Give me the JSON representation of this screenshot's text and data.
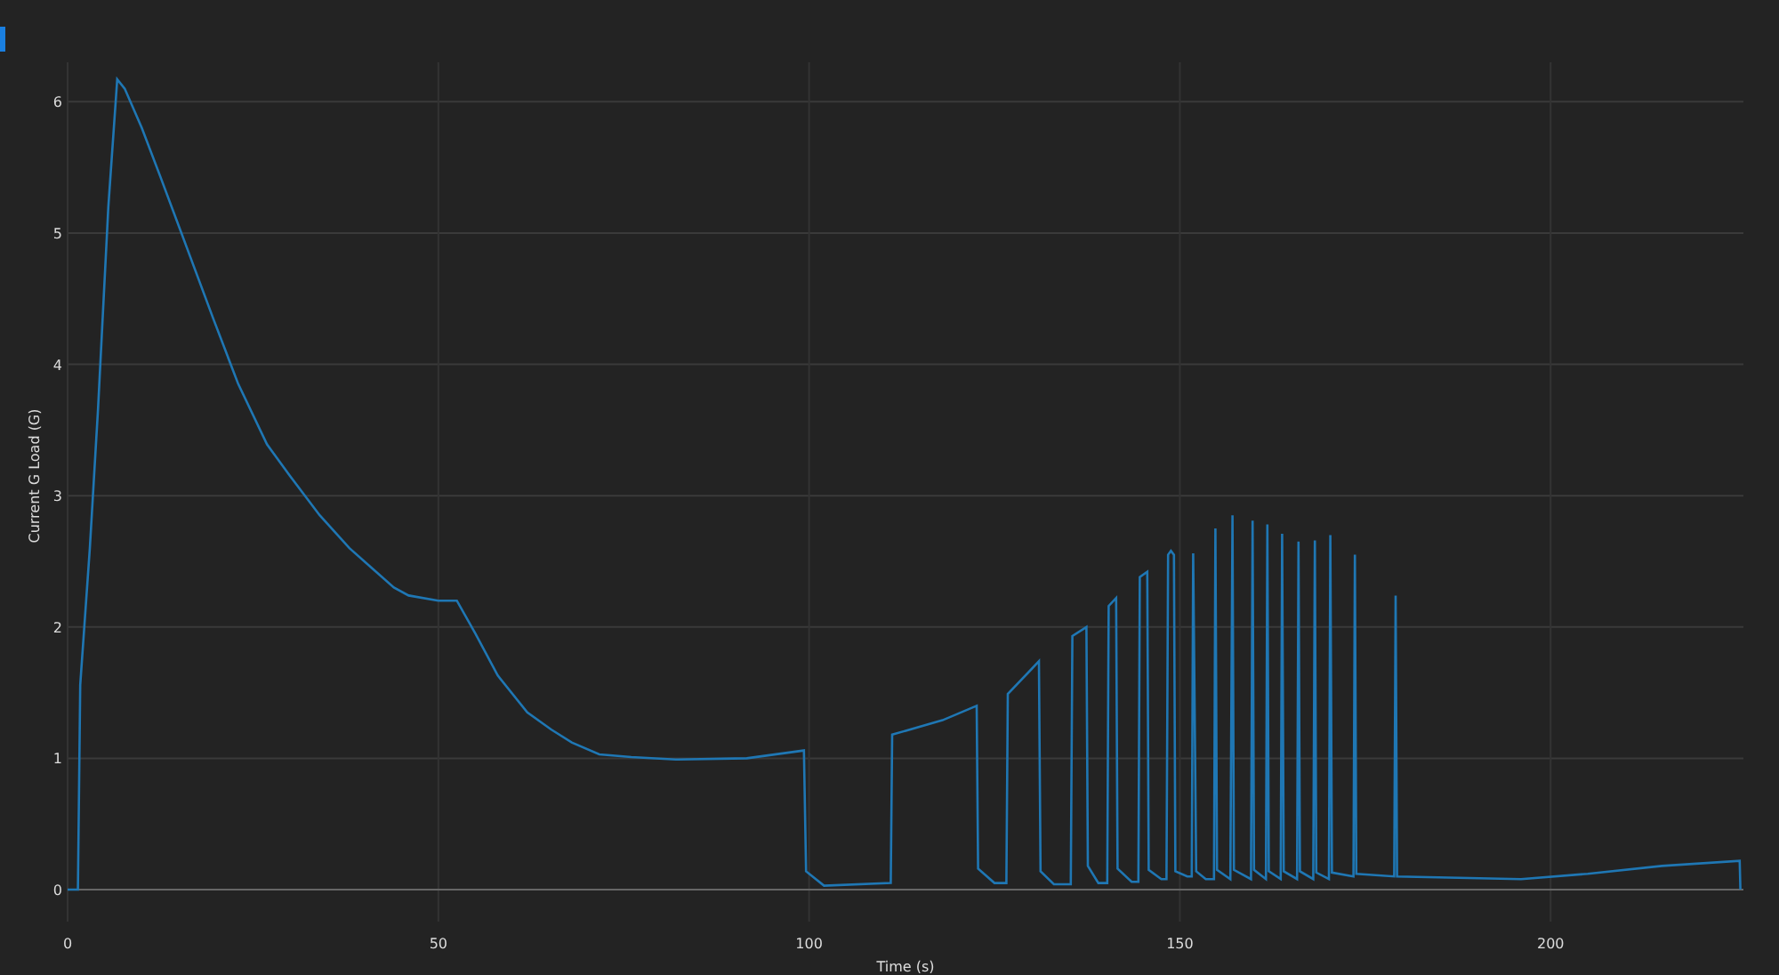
{
  "chart": {
    "chart_data": {
      "type": "line",
      "xlabel": "Time (s)",
      "ylabel": "Current G Load (G)",
      "x": [
        0,
        1.4,
        1.7,
        3,
        4.1,
        5.5,
        6.7,
        7.7,
        10,
        12.5,
        16,
        19.7,
        23,
        26.9,
        30,
        34,
        38,
        41.2,
        44,
        46,
        50,
        52.5,
        55,
        58,
        62,
        65.2,
        68,
        71.7,
        76,
        82,
        91.6,
        99.3,
        99.6,
        102,
        111,
        111.2,
        118,
        122.6,
        122.8,
        125,
        126.6,
        126.8,
        130,
        131,
        131.2,
        133,
        135.3,
        135.5,
        137.4,
        137.6,
        139,
        140.2,
        140.4,
        141.4,
        141.6,
        143.5,
        144.4,
        144.6,
        145.6,
        145.8,
        147.5,
        148.2,
        148.4,
        148.8,
        149.2,
        149.4,
        151,
        151.6,
        151.8,
        152.2,
        153.5,
        154.6,
        154.8,
        155,
        156.8,
        157.1,
        157.3,
        159.6,
        159.8,
        160,
        161.6,
        161.8,
        162,
        163.6,
        163.8,
        164,
        165.8,
        166,
        166.2,
        168,
        168.2,
        168.4,
        170.1,
        170.3,
        170.5,
        173.4,
        173.6,
        173.8,
        178.9,
        179.1,
        179.3,
        196,
        205,
        215,
        225.5,
        225.6
      ],
      "series": [
        {
          "color": "#1f77b4",
          "values": [
            0,
            0,
            1.56,
            2.6,
            3.66,
            5.2,
            6.17,
            6.1,
            5.8,
            5.43,
            4.9,
            4.34,
            3.85,
            3.39,
            3.15,
            2.85,
            2.6,
            2.44,
            2.3,
            2.24,
            2.2,
            2.2,
            1.95,
            1.63,
            1.35,
            1.22,
            1.12,
            1.03,
            1.01,
            0.99,
            1.0,
            1.06,
            0.14,
            0.03,
            0.05,
            1.18,
            1.29,
            1.4,
            0.16,
            0.05,
            0.05,
            1.49,
            1.68,
            1.74,
            0.14,
            0.04,
            0.04,
            1.93,
            2.0,
            0.18,
            0.05,
            0.05,
            2.16,
            2.22,
            0.16,
            0.06,
            0.06,
            2.38,
            2.42,
            0.15,
            0.08,
            0.08,
            2.55,
            2.58,
            2.55,
            0.14,
            0.1,
            0.1,
            2.56,
            0.14,
            0.08,
            0.08,
            2.75,
            0.15,
            0.08,
            2.85,
            0.15,
            0.08,
            2.81,
            0.15,
            0.08,
            2.78,
            0.14,
            0.08,
            2.71,
            0.14,
            0.08,
            2.65,
            0.14,
            0.08,
            2.66,
            0.13,
            0.08,
            2.7,
            0.13,
            0.1,
            2.55,
            0.12,
            0.1,
            2.24,
            0.1,
            0.08,
            0.12,
            0.18,
            0.22,
            0
          ]
        }
      ],
      "grid": true,
      "xlim": [
        0,
        226
      ],
      "ylim": [
        0,
        6.3
      ],
      "xticks": [
        0,
        50,
        100,
        150,
        200
      ],
      "yticks": [
        0,
        1,
        2,
        3,
        4,
        5,
        6
      ]
    }
  }
}
